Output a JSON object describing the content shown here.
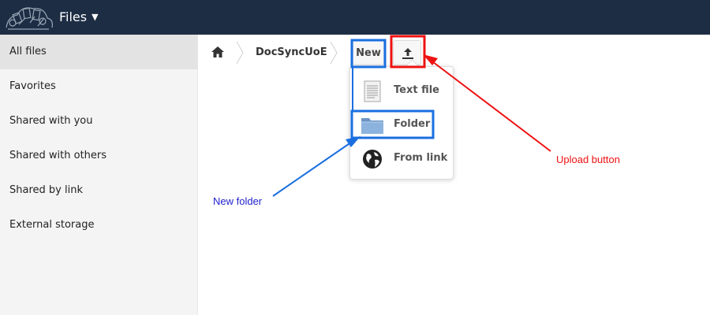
{
  "header": {
    "app_title": "Files",
    "menu_caret": "▼",
    "logo_icon": "cloud-logo-icon",
    "background": "#1d2d44"
  },
  "sidebar": {
    "items": [
      {
        "label": "All files",
        "active": true
      },
      {
        "label": "Favorites"
      },
      {
        "label": "Shared with you"
      },
      {
        "label": "Shared with others"
      },
      {
        "label": "Shared by link"
      },
      {
        "label": "External storage"
      }
    ]
  },
  "breadcrumb": {
    "home_icon": "home-icon",
    "folder": "DocSyncUoE"
  },
  "toolbar": {
    "new_label": "New",
    "upload_icon": "upload-icon"
  },
  "new_menu": {
    "items": [
      {
        "label": "Text file",
        "icon": "text-file-icon"
      },
      {
        "label": "Folder",
        "icon": "folder-icon"
      },
      {
        "label": "From link",
        "icon": "globe-icon"
      }
    ]
  },
  "annotations": {
    "upload": {
      "label": "Upload button",
      "color": "#ee1111"
    },
    "folder": {
      "label": "New folder",
      "color": "#1a6fe0",
      "text_color": "#2222cc"
    }
  }
}
